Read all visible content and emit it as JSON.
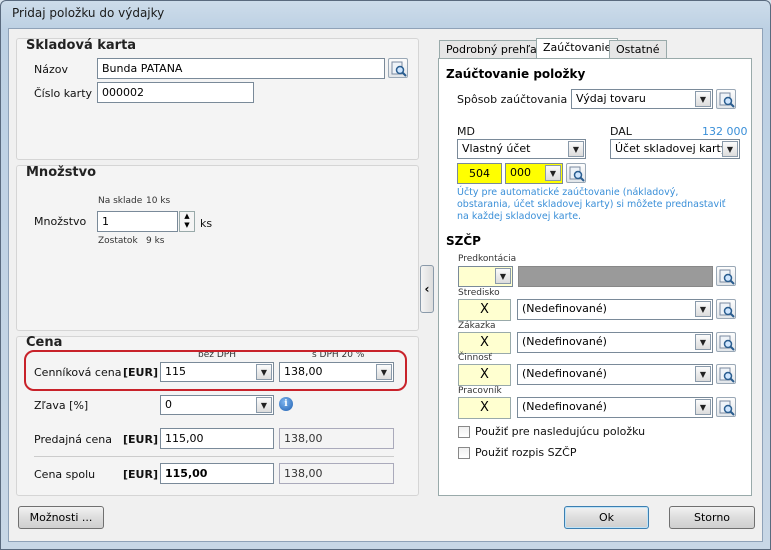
{
  "window": {
    "title": "Pridaj položku do výdajky"
  },
  "karta": {
    "title": "Skladová karta",
    "nazov_label": "Názov",
    "nazov_value": "Bunda PATANA",
    "cislo_label": "Číslo karty",
    "cislo_value": "000002"
  },
  "mnozstvo": {
    "title": "Množstvo",
    "na_sklade_label": "Na sklade",
    "na_sklade_value": "10 ks",
    "label": "Množstvo",
    "value": "1",
    "unit": "ks",
    "zostatok_label": "Zostatok",
    "zostatok_value": "9 ks"
  },
  "cena": {
    "title": "Cena",
    "bez_dph_header": "bez DPH",
    "s_dph_header": "s DPH 20 %",
    "cennikova_label": "Cenníková cena",
    "currency": "[EUR]",
    "cennikova_bez": "115",
    "cennikova_s": "138,00",
    "zlava_label": "Zľava [%]",
    "zlava_value": "0",
    "predajna_label": "Predajná cena",
    "predajna_bez": "115,00",
    "predajna_s": "138,00",
    "spolu_label": "Cena spolu",
    "spolu_bez": "115,00",
    "spolu_s": "138,00"
  },
  "footer": {
    "moznosti_label": "Možnosti ...",
    "ok_label": "Ok",
    "storno_label": "Storno"
  },
  "tabs": [
    {
      "label": "Podrobný prehľad"
    },
    {
      "label": "Zaúčtovanie"
    },
    {
      "label": "Ostatné"
    }
  ],
  "zauctovanie": {
    "title": "Zaúčtovanie položky",
    "sposob_label": "Spôsob zaúčtovania",
    "sposob_value": "Výdaj tovaru",
    "md_label": "MD",
    "dal_label": "DAL",
    "dal_account": "132 000",
    "md_value": "Vlastný účet",
    "dal_value": "Účet skladovej karty",
    "synt": "504",
    "anal": "000",
    "info_text": "Účty pre automatické zaúčtovanie (nákladový, obstarania, účet skladovej karty) si môžete prednastaviť na každej skladovej karte."
  },
  "szcp": {
    "title": "SZČP",
    "predkontacia_label": "Predkontácia",
    "stredisko_label": "Stredisko",
    "zakazka_label": "Zákazka",
    "cinnost_label": "Činnosť",
    "pracovnik_label": "Pracovník",
    "x_mark": "X",
    "undefined_value": "(Nedefinované)",
    "chk_nasledujucu": "Použiť pre nasledujúcu položku",
    "chk_rozpis": "Použiť rozpis SZČP"
  }
}
